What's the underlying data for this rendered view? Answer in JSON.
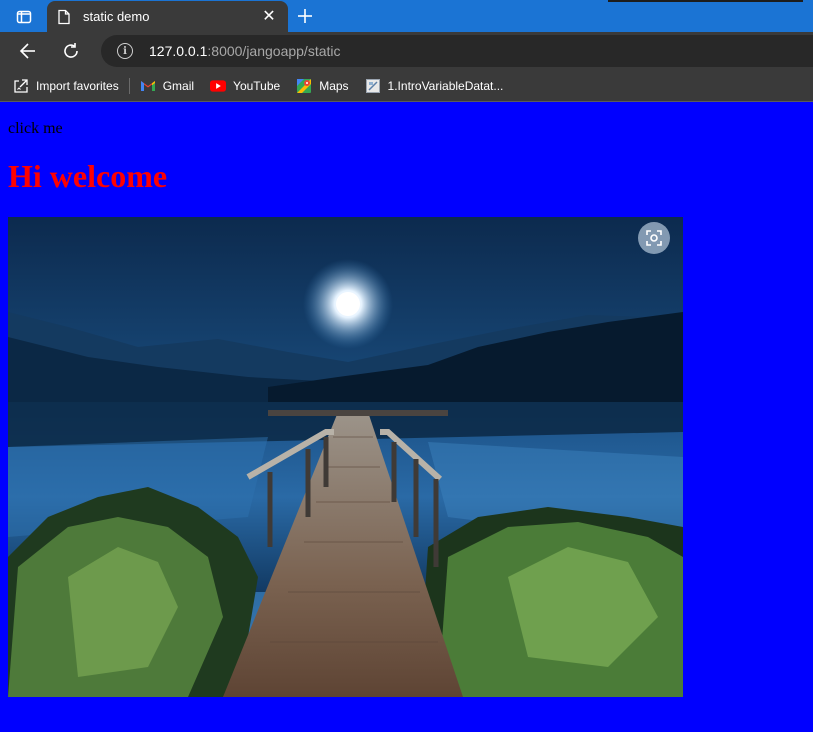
{
  "browser": {
    "tab_title": "static demo",
    "address": {
      "host": "127.0.0.1",
      "path": ":8000/jangoapp/static"
    },
    "bookmarks": [
      {
        "label": "Import favorites",
        "icon": "import-favorites-icon"
      },
      {
        "label": "Gmail",
        "icon": "gmail-icon"
      },
      {
        "label": "YouTube",
        "icon": "youtube-icon"
      },
      {
        "label": "Maps",
        "icon": "maps-icon"
      },
      {
        "label": "1.IntroVariableDatat...",
        "icon": "page-icon"
      }
    ]
  },
  "page": {
    "link_text": "click me",
    "heading": "Hi welcome",
    "background_color": "#0000ff",
    "heading_color": "#ff0000",
    "image": "moonlit-lake-pier-photo"
  }
}
